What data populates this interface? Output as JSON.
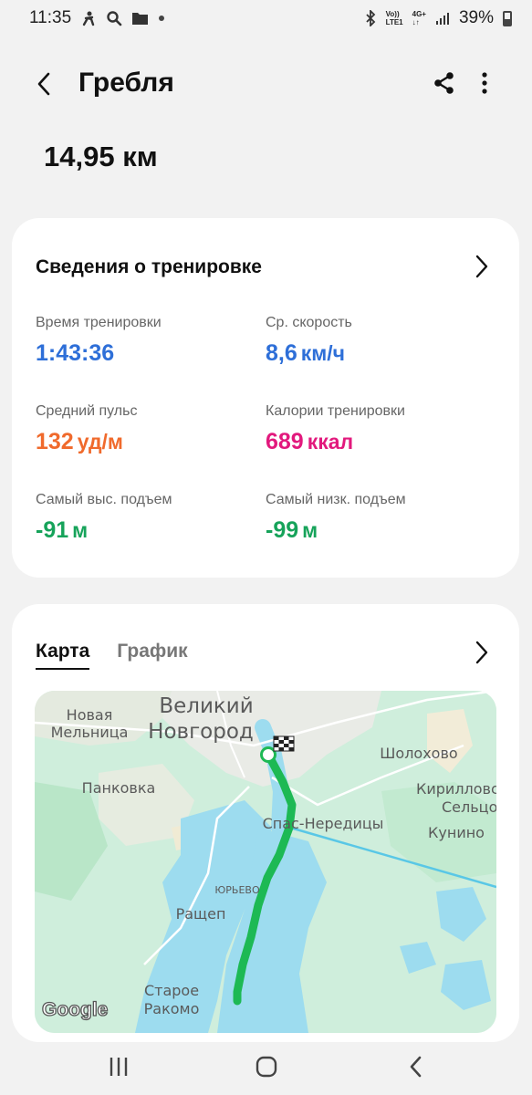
{
  "status_bar": {
    "time": "11:35",
    "volte_top": "Vo))",
    "volte_bottom": "LTE1",
    "network_top": "4G+",
    "network_bottom": "↓↑",
    "battery": "39%"
  },
  "header": {
    "title": "Гребля"
  },
  "summary": {
    "distance": "14,95 км"
  },
  "details_card": {
    "title": "Сведения о тренировке",
    "stats": [
      {
        "label": "Время тренировки",
        "value": "1:43:36",
        "unit": "",
        "color": "#2e6fd8"
      },
      {
        "label": "Ср. скорость",
        "value": "8,6",
        "unit": "км/ч",
        "color": "#2e6fd8"
      },
      {
        "label": "Средний пульс",
        "value": "132",
        "unit": "уд/м",
        "color": "#f06a2c"
      },
      {
        "label": "Калории тренировки",
        "value": "689",
        "unit": "ккал",
        "color": "#e2197d"
      },
      {
        "label": "Самый выс. подъем",
        "value": "-91",
        "unit": "м",
        "color": "#16a35a"
      },
      {
        "label": "Самый низк. подъем",
        "value": "-99",
        "unit": "м",
        "color": "#16a35a"
      }
    ]
  },
  "map_card": {
    "tabs": [
      "Карта",
      "График"
    ],
    "active_tab": "Карта",
    "map_labels": {
      "city_line1": "Великий",
      "city_line2": "Новгород",
      "novaya_line1": "Новая",
      "novaya_line2": "Мельница",
      "pankovka": "Панковка",
      "spas": "Спас-Нередицы",
      "sholokhovo": "Шолохово",
      "kirillovo": "Кирилловс",
      "seltso": "Сельцо",
      "kunino": "Кунино",
      "yurevo": "ЮРЬЕВО",
      "rashchep": "Ращеп",
      "staroe_line1": "Старое",
      "staroe_line2": "Ракомо",
      "google": "Google"
    },
    "route_color": "#1db954"
  }
}
